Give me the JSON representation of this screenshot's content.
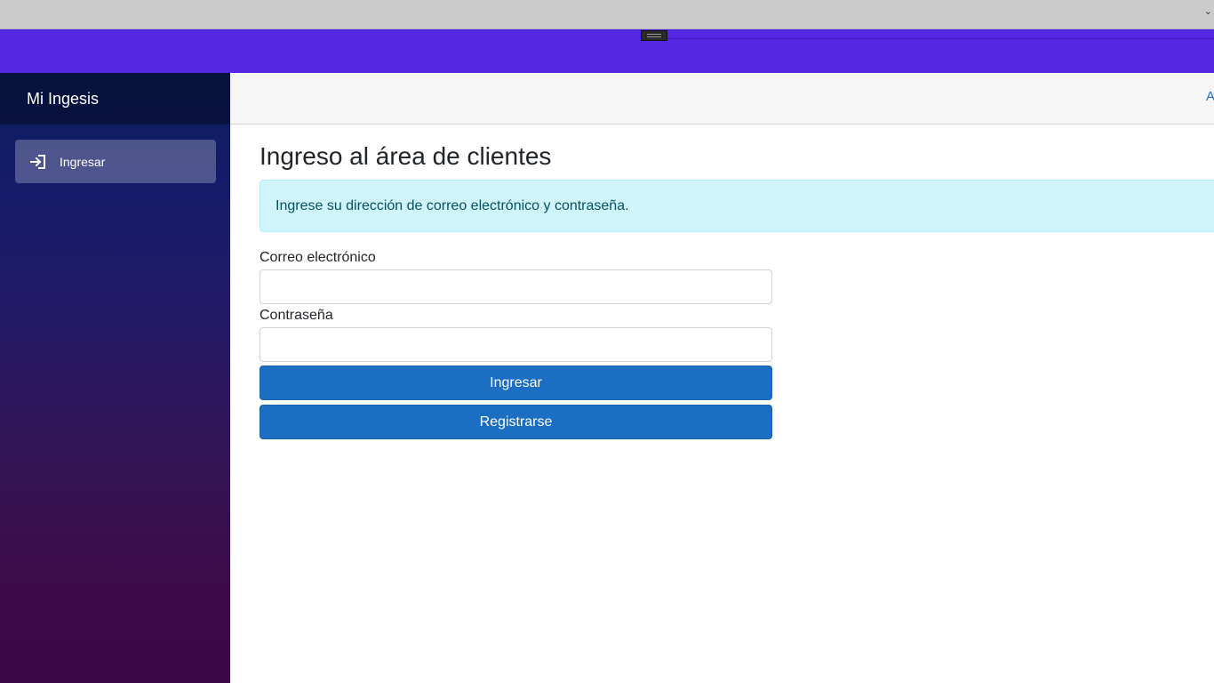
{
  "app": {
    "brand": "Mi Ingesis"
  },
  "sidebar": {
    "items": [
      {
        "label": "Ingresar",
        "icon": "login-arrow-icon"
      }
    ]
  },
  "topbar": {
    "link_label": "About"
  },
  "page": {
    "title": "Ingreso al área de clientes",
    "alert": "Ingrese su dirección de correo electrónico y contraseña."
  },
  "form": {
    "email_label": "Correo electrónico",
    "email_value": "",
    "password_label": "Contraseña",
    "password_value": "",
    "login_button": "Ingresar",
    "register_button": "Registrarse"
  },
  "colors": {
    "top_band": "#5428e3",
    "primary_button": "#1b6ec2",
    "alert_bg": "#cff4fc",
    "alert_text": "#055160",
    "sidebar_top": "#0a1e5c",
    "sidebar_bottom": "#3c0845"
  }
}
